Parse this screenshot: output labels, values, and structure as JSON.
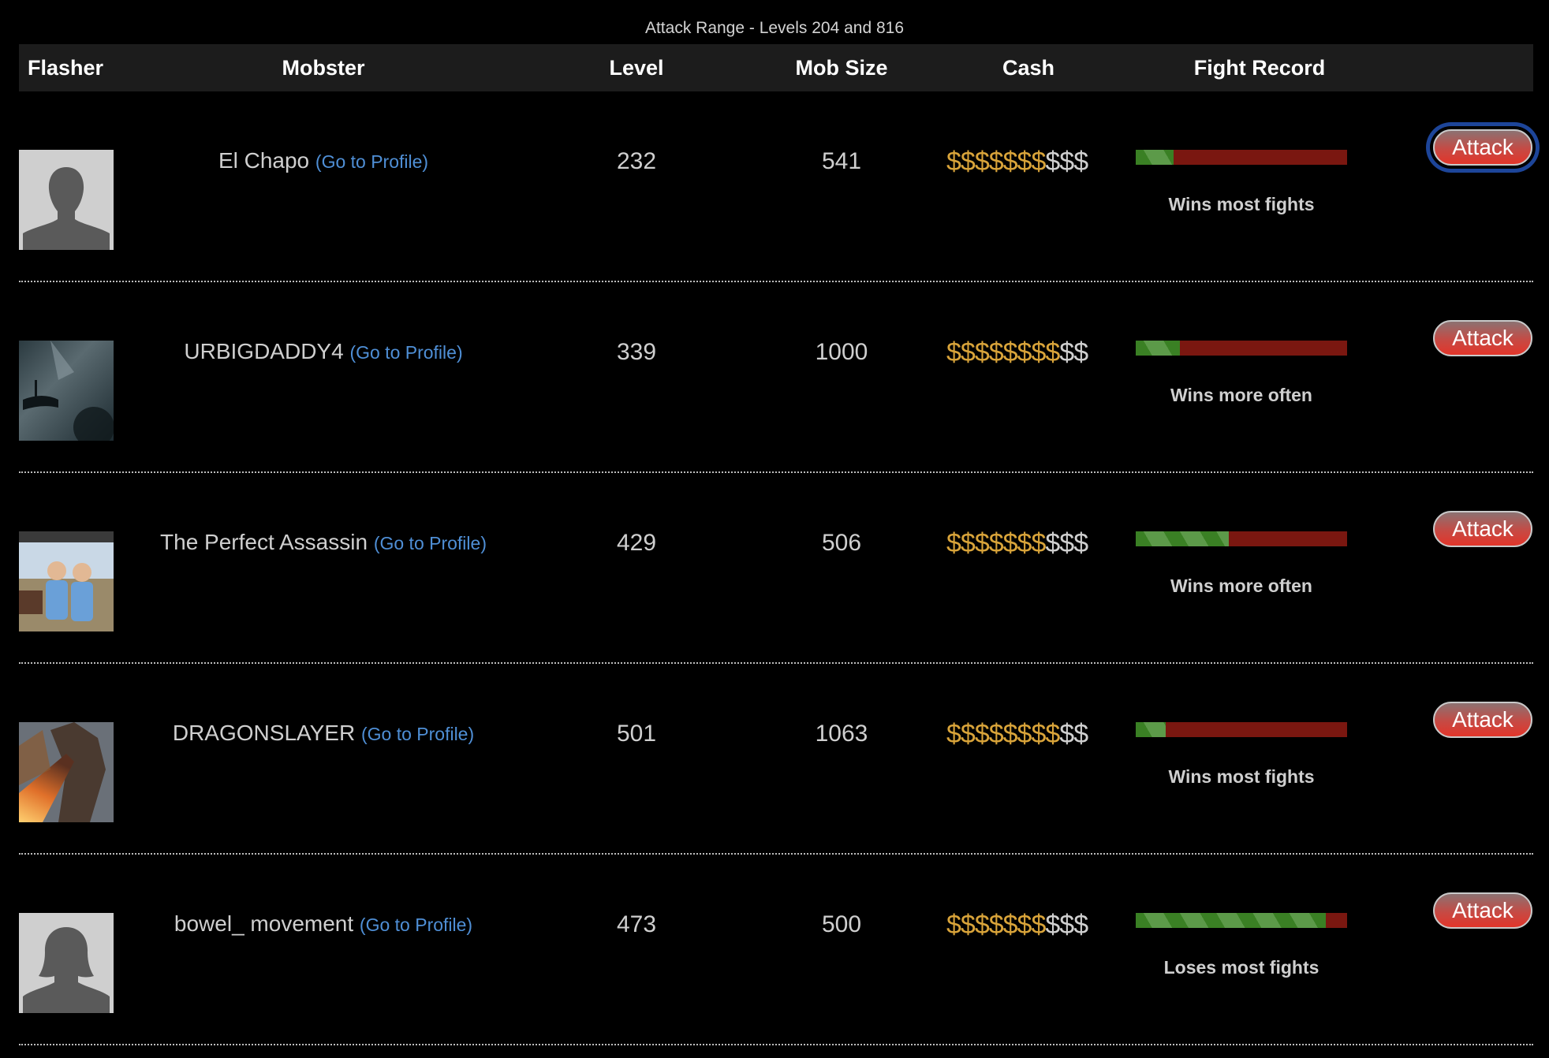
{
  "title": "Attack Range - Levels 204 and 816",
  "columns": [
    "Flasher",
    "Mobster",
    "Level",
    "Mob Size",
    "Cash",
    "Fight Record"
  ],
  "profile_link_label": "(Go to Profile)",
  "attack_label": "Attack",
  "colors": {
    "cash_filled": "#d9a43a",
    "cash_empty": "#cfcfcf",
    "bar_win": "#3a8024",
    "bar_loss": "#7a1710",
    "link": "#4f8fd6",
    "attack_button": "#e2352a",
    "focus_ring": "#1d4599"
  },
  "rows": [
    {
      "avatar": "default-male-silhouette",
      "name": "El Chapo",
      "level": "232",
      "mob_size": "541",
      "cash_filled": "$$$$$$$",
      "cash_empty": "$$$",
      "cash_rating": 7,
      "cash_max": 10,
      "fight_record_green_fraction": 0.18,
      "fight_record_label": "Wins most fights",
      "attack_focused": true
    },
    {
      "avatar": "stormy-sea-photo",
      "name": "URBIGDADDY4",
      "level": "339",
      "mob_size": "1000",
      "cash_filled": "$$$$$$$$",
      "cash_empty": "$$",
      "cash_rating": 8,
      "cash_max": 10,
      "fight_record_green_fraction": 0.21,
      "fight_record_label": "Wins more often",
      "attack_focused": false
    },
    {
      "avatar": "two-boys-photo",
      "name": "The Perfect Assassin",
      "level": "429",
      "mob_size": "506",
      "cash_filled": "$$$$$$$",
      "cash_empty": "$$$",
      "cash_rating": 7,
      "cash_max": 10,
      "fight_record_green_fraction": 0.44,
      "fight_record_label": "Wins more often",
      "attack_focused": false
    },
    {
      "avatar": "fire-dragon-image",
      "name": "DRAGONSLAYER",
      "level": "501",
      "mob_size": "1063",
      "cash_filled": "$$$$$$$$",
      "cash_empty": "$$",
      "cash_rating": 8,
      "cash_max": 10,
      "fight_record_green_fraction": 0.14,
      "fight_record_label": "Wins most fights",
      "attack_focused": false
    },
    {
      "avatar": "default-female-silhouette",
      "name": "bowel_ movement",
      "level": "473",
      "mob_size": "500",
      "cash_filled": "$$$$$$$",
      "cash_empty": "$$$",
      "cash_rating": 7,
      "cash_max": 10,
      "fight_record_green_fraction": 0.9,
      "fight_record_label": "Loses most fights",
      "attack_focused": false
    }
  ]
}
